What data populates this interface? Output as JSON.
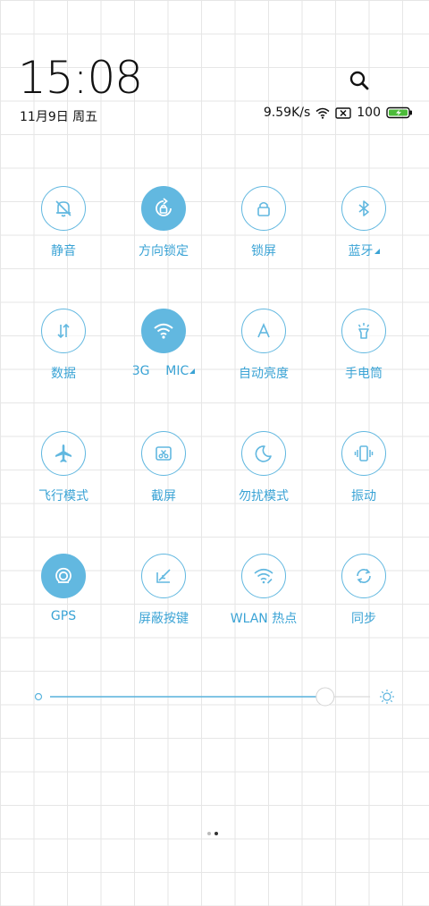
{
  "status": {
    "time": "15:08",
    "date": "11月9日 周五",
    "net_speed": "9.59K/s",
    "battery": "100"
  },
  "tiles": [
    {
      "label": "静音",
      "icon": "bell-off-icon",
      "active": false
    },
    {
      "label": "方向锁定",
      "icon": "rotation-lock-icon",
      "active": true
    },
    {
      "label": "锁屏",
      "icon": "lock-icon",
      "active": false
    },
    {
      "label": "蓝牙",
      "icon": "bluetooth-icon",
      "active": false
    },
    {
      "label": "数据",
      "icon": "data-arrows-icon",
      "active": false
    },
    {
      "label": "3G    MIC",
      "icon": "wifi-icon",
      "active": true
    },
    {
      "label": "自动亮度",
      "icon": "auto-brightness-icon",
      "active": false
    },
    {
      "label": "手电筒",
      "icon": "flashlight-icon",
      "active": false
    },
    {
      "label": "飞行模式",
      "icon": "airplane-icon",
      "active": false
    },
    {
      "label": "截屏",
      "icon": "screenshot-icon",
      "active": false
    },
    {
      "label": "勿扰模式",
      "icon": "moon-icon",
      "active": false
    },
    {
      "label": "振动",
      "icon": "vibrate-icon",
      "active": false
    },
    {
      "label": "GPS",
      "icon": "gps-icon",
      "active": true
    },
    {
      "label": "屏蔽按键",
      "icon": "block-keys-icon",
      "active": false
    },
    {
      "label": "WLAN 热点",
      "icon": "hotspot-icon",
      "active": false
    },
    {
      "label": "同步",
      "icon": "sync-icon",
      "active": false
    }
  ],
  "brightness": {
    "level": 0.95
  },
  "pager": {
    "pages": 2,
    "current": 2
  },
  "colors": {
    "accent": "#62b8e0",
    "label": "#3aa3d5",
    "battery": "#4cbb3a"
  }
}
